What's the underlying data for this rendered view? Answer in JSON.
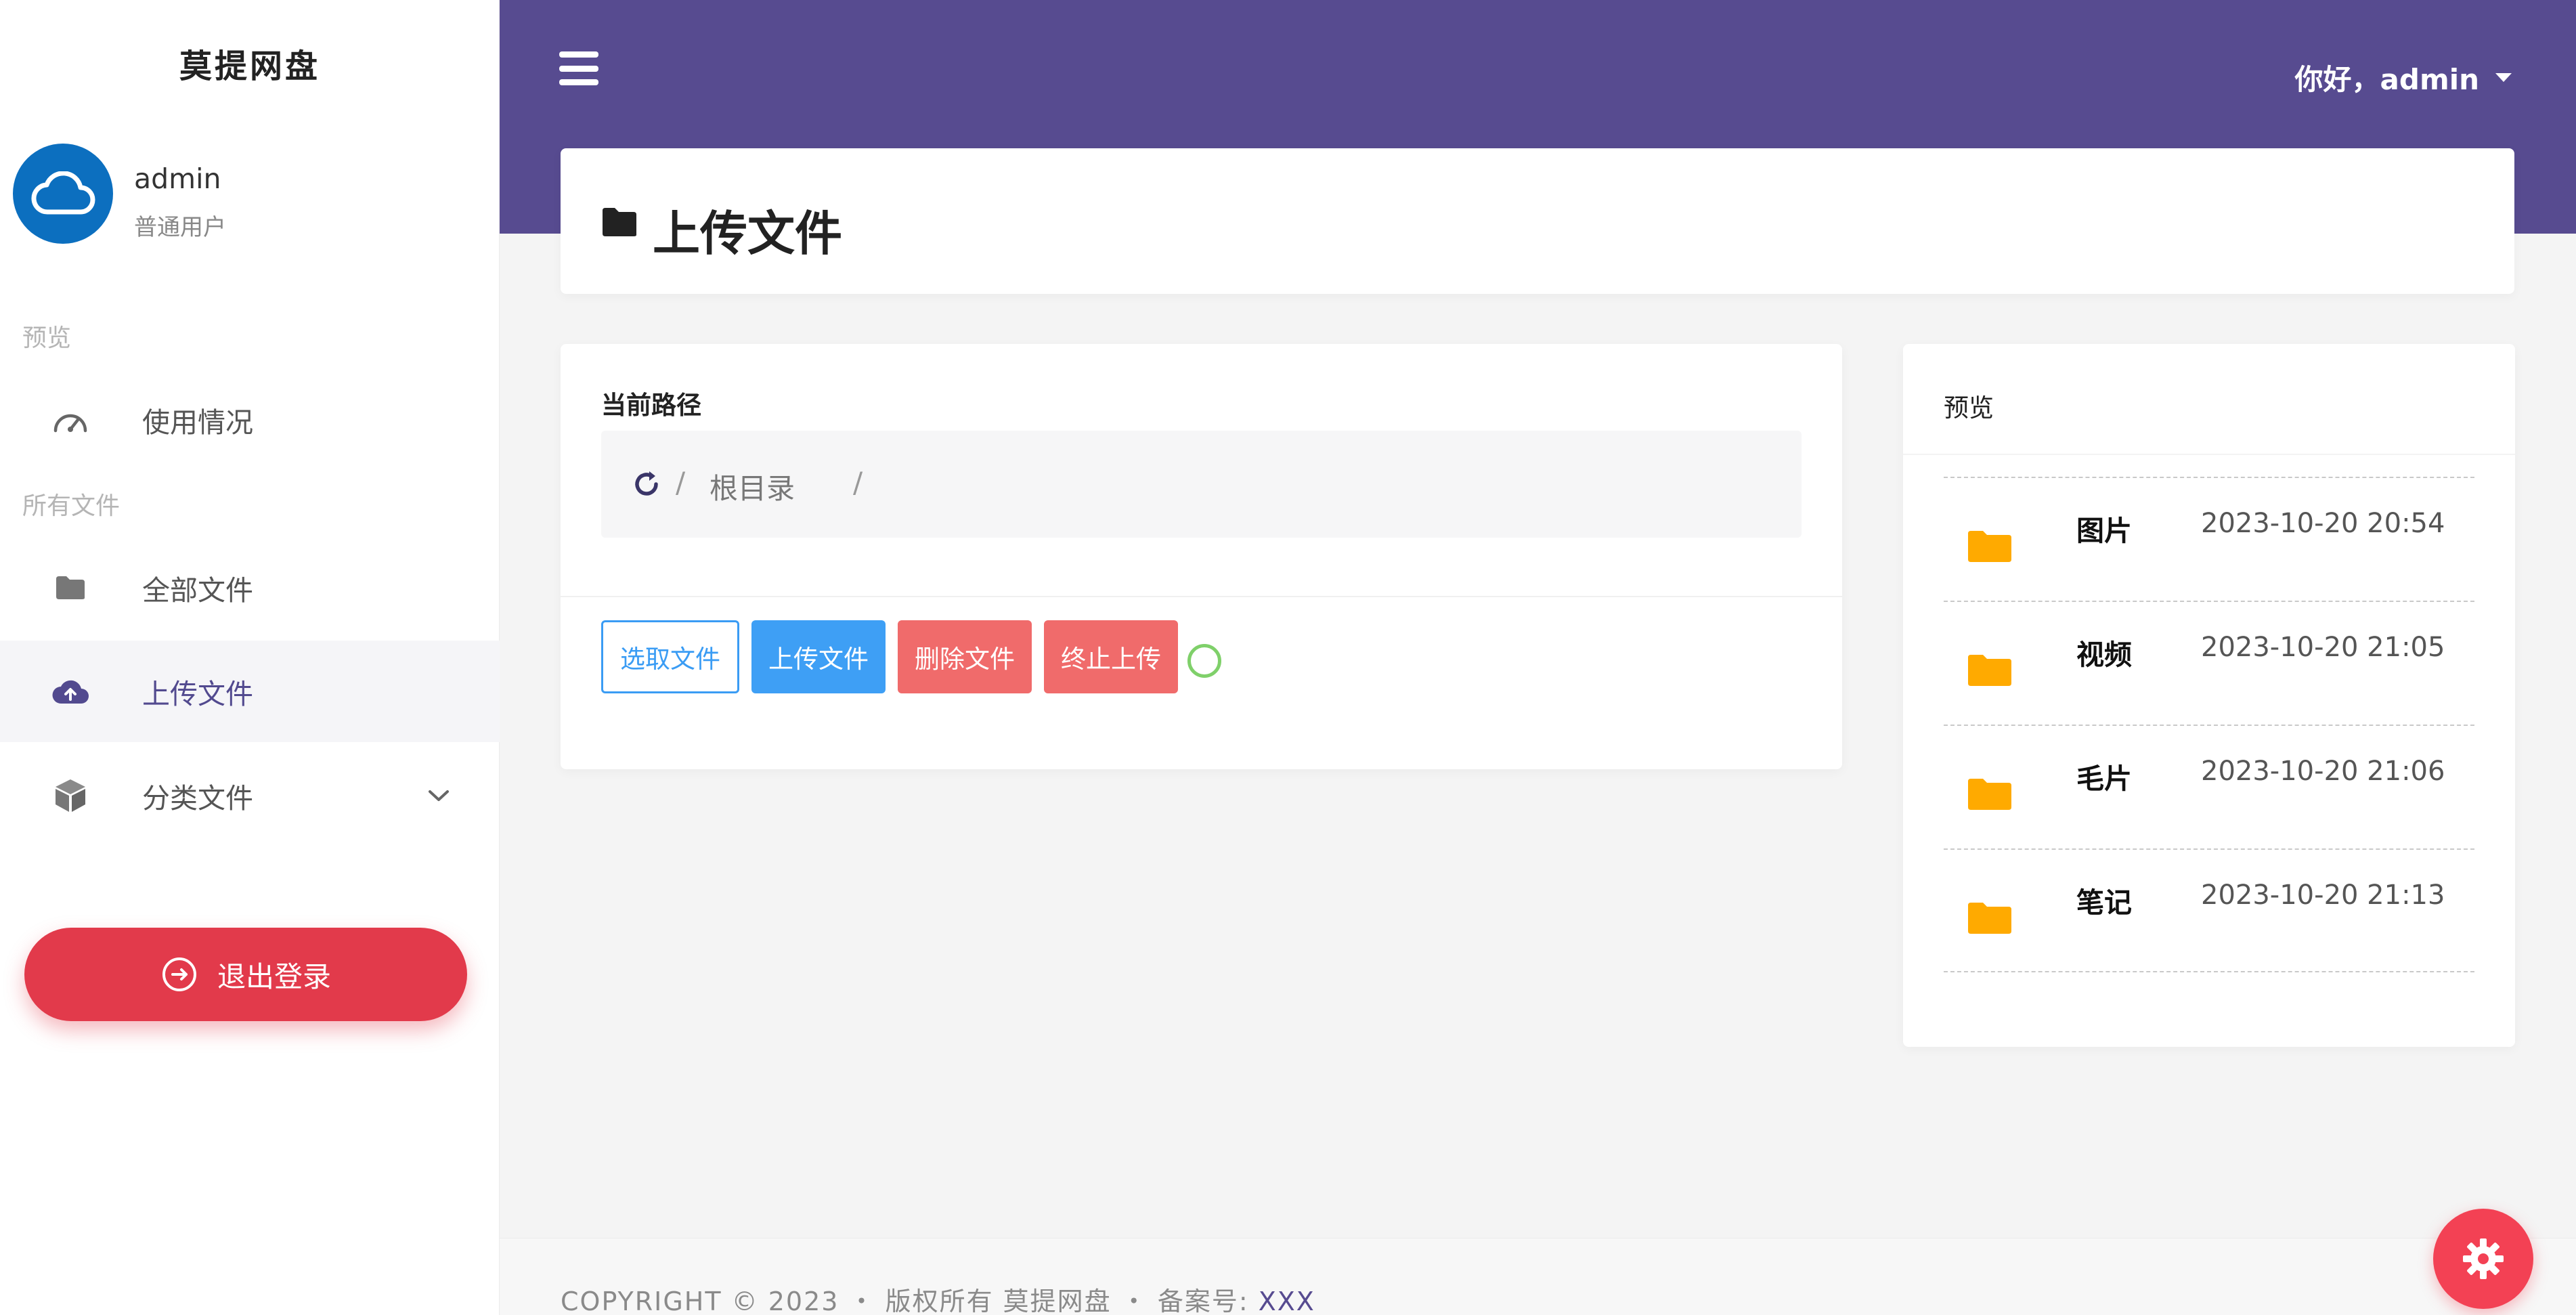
{
  "sidebar": {
    "brand": "莫提网盘",
    "user": {
      "name": "admin",
      "role": "普通用户",
      "avatar_icon": "cloud-icon",
      "avatar_color": "#0c6fbf"
    },
    "sections": [
      {
        "label": "预览"
      },
      {
        "label": "所有文件"
      }
    ],
    "items": [
      {
        "label": "使用情况",
        "icon": "dashboard-gauge-icon"
      },
      {
        "label": "全部文件",
        "icon": "folder-icon"
      },
      {
        "label": "上传文件",
        "icon": "cloud-upload-icon",
        "active": true
      },
      {
        "label": "分类文件",
        "icon": "cube-icon",
        "expandable": true
      }
    ],
    "logout_label": "退出登录"
  },
  "header": {
    "greeting": "你好，admin",
    "menu_icon": "hamburger-menu-icon",
    "background": "#574b90"
  },
  "page": {
    "title": "上传文件",
    "title_icon": "folder-icon"
  },
  "path": {
    "label": "当前路径",
    "separator": "/",
    "root": "根目录"
  },
  "actions": {
    "select": "选取文件",
    "upload": "上传文件",
    "delete": "删除文件",
    "stop": "终止上传"
  },
  "preview": {
    "title": "预览",
    "folders": [
      {
        "name": "图片",
        "date": "2023-10-20 20:54"
      },
      {
        "name": "视频",
        "date": "2023-10-20 21:05"
      },
      {
        "name": "毛片",
        "date": "2023-10-20 21:06"
      },
      {
        "name": "笔记",
        "date": "2023-10-20 21:13"
      }
    ]
  },
  "footer": {
    "copyright": "COPYRIGHT © 2023 ・ 版权所有 莫提网盘 ・ 备案号: ",
    "beian": "XXX"
  },
  "colors": {
    "accent": "#574b90",
    "danger": "#e23a4b",
    "primary": "#3e9ff5",
    "folder": "#ffaa00"
  }
}
